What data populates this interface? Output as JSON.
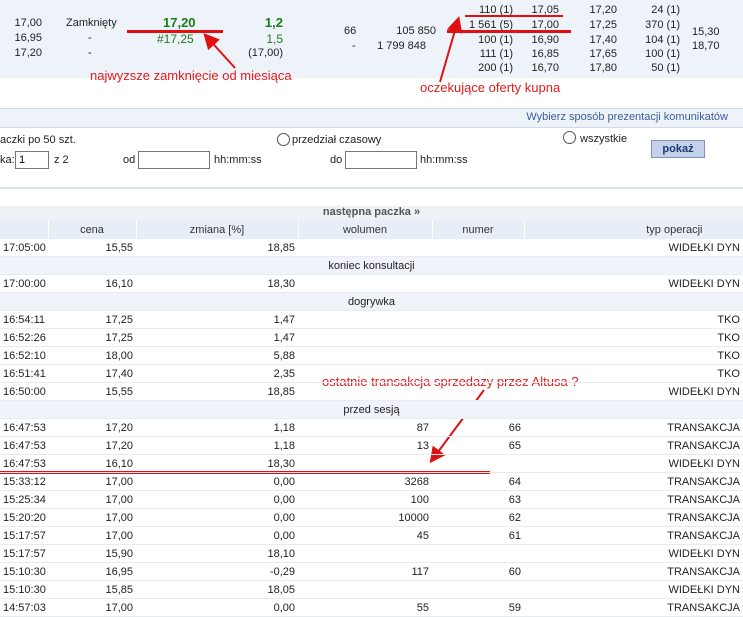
{
  "quote": {
    "col1": [
      "17,00",
      "16,95",
      "17,20"
    ],
    "status": [
      "Zamknięty",
      "-",
      "-"
    ],
    "close": "17,20",
    "close2": "#17,25",
    "change": [
      "1,2",
      "1,5",
      "(17,00)"
    ],
    "num66": "66",
    "dash": "-",
    "volume": [
      "105 850",
      "1 799 848"
    ],
    "bid_qty": [
      "110 (1)",
      "1 561 (5)",
      "100 (1)",
      "111 (1)",
      "200 (1)"
    ],
    "bid_price": [
      "17,05",
      "17,00",
      "16,90",
      "16,85",
      "16,70"
    ],
    "ask_price": [
      "17,20",
      "17,25",
      "17,40",
      "17,65",
      "17,80"
    ],
    "ask_qty": [
      "24 (1)",
      "370 (1)",
      "104 (1)",
      "100 (1)",
      "50 (1)"
    ],
    "extra": [
      "15,30",
      "18,70"
    ]
  },
  "annotations": {
    "highest_close": "najwyzsze zamknięcie od miesiąca",
    "buy_orders": "oczekujące oferty kupna",
    "last_sale": "ostatnie transakcja sprzedazy przez Altusa ?"
  },
  "options": {
    "header": "Wybierz sposób prezentacji komunikatów",
    "packs_label": "aczki po 50 szt.",
    "page_label": "ka:",
    "page_value": "1",
    "page_of": "z 2",
    "radio_interval": "przedział czasowy",
    "radio_all": "wszystkie",
    "from_label": "od",
    "to_label": "do",
    "time_fmt1": "hh:mm:ss",
    "time_fmt2": "hh:mm:ss",
    "show_button": "pokaż"
  },
  "next_pack": "następna paczka »",
  "trades": {
    "headers": [
      "",
      "cena",
      "zmiana [%]",
      "wolumen",
      "numer",
      "typ operacji"
    ],
    "rows": [
      {
        "t": "17:05:00",
        "p": "15,55",
        "c": "18,85",
        "v": "",
        "n": "",
        "op": "WIDEŁKI DYN"
      },
      {
        "sec": "koniec konsultacji"
      },
      {
        "t": "17:00:00",
        "p": "16,10",
        "c": "18,30",
        "v": "",
        "n": "",
        "op": "WIDEŁKI DYN"
      },
      {
        "sec": "dogrywka"
      },
      {
        "t": "16:54:11",
        "p": "17,25",
        "c": "1,47",
        "v": "",
        "n": "",
        "op": "TKO"
      },
      {
        "t": "16:52:26",
        "p": "17,25",
        "c": "1,47",
        "v": "",
        "n": "",
        "op": "TKO"
      },
      {
        "t": "16:52:10",
        "p": "18,00",
        "c": "5,88",
        "v": "",
        "n": "",
        "op": "TKO"
      },
      {
        "t": "16:51:41",
        "p": "17,40",
        "c": "2,35",
        "v": "",
        "n": "",
        "op": "TKO"
      },
      {
        "t": "16:50:00",
        "p": "15,55",
        "c": "18,85",
        "v": "",
        "n": "",
        "op": "WIDEŁKI DYN"
      },
      {
        "sec": "przed sesją"
      },
      {
        "t": "16:47:53",
        "p": "17,20",
        "c": "1,18",
        "v": "87",
        "n": "66",
        "op": "TRANSAKCJA"
      },
      {
        "t": "16:47:53",
        "p": "17,20",
        "c": "1,18",
        "v": "13",
        "n": "65",
        "op": "TRANSAKCJA"
      },
      {
        "t": "16:47:53",
        "p": "16,10",
        "c": "18,30",
        "v": "",
        "n": "",
        "op": "WIDEŁKI DYN"
      },
      {
        "t": "15:33:12",
        "p": "17,00",
        "c": "0,00",
        "v": "3268",
        "n": "64",
        "op": "TRANSAKCJA"
      },
      {
        "t": "15:25:34",
        "p": "17,00",
        "c": "0,00",
        "v": "100",
        "n": "63",
        "op": "TRANSAKCJA"
      },
      {
        "t": "15:20:20",
        "p": "17,00",
        "c": "0,00",
        "v": "10000",
        "n": "62",
        "op": "TRANSAKCJA"
      },
      {
        "t": "15:17:57",
        "p": "17,00",
        "c": "0,00",
        "v": "45",
        "n": "61",
        "op": "TRANSAKCJA"
      },
      {
        "t": "15:17:57",
        "p": "15,90",
        "c": "18,10",
        "v": "",
        "n": "",
        "op": "WIDEŁKI DYN"
      },
      {
        "t": "15:10:30",
        "p": "16,95",
        "c": "-0,29",
        "v": "117",
        "n": "60",
        "op": "TRANSAKCJA"
      },
      {
        "t": "15:10:30",
        "p": "15,85",
        "c": "18,05",
        "v": "",
        "n": "",
        "op": "WIDEŁKI DYN"
      },
      {
        "t": "14:57:03",
        "p": "17,00",
        "c": "0,00",
        "v": "55",
        "n": "59",
        "op": "TRANSAKCJA"
      }
    ]
  }
}
